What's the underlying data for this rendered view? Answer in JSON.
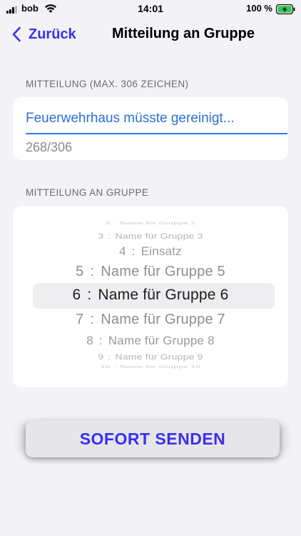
{
  "status_bar": {
    "carrier": "bob",
    "time": "14:01",
    "battery": "100 %"
  },
  "nav": {
    "back_label": "Zurück",
    "title": "Mitteilung an Gruppe"
  },
  "message_section": {
    "label": "MITTEILUNG (MAX. 306 ZEICHEN)",
    "value": "Feuerwehrhaus müsste gereinigt...",
    "counter": "268/306"
  },
  "group_section": {
    "label": "MITTEILUNG AN GRUPPE",
    "selected_index": 4,
    "options": [
      {
        "num": "2",
        "sep": ":",
        "name": "Name für Gruppe 2"
      },
      {
        "num": "3",
        "sep": ":",
        "name": "Name für Gruppe 3"
      },
      {
        "num": "4",
        "sep": ":",
        "name": "Einsatz"
      },
      {
        "num": "5",
        "sep": ":",
        "name": "Name für Gruppe 5"
      },
      {
        "num": "6",
        "sep": ":",
        "name": "Name für Gruppe 6"
      },
      {
        "num": "7",
        "sep": ":",
        "name": "Name für Gruppe 7"
      },
      {
        "num": "8",
        "sep": ":",
        "name": "Name für Gruppe 8"
      },
      {
        "num": "9",
        "sep": ":",
        "name": "Name für Gruppe 9"
      },
      {
        "num": "10",
        "sep": ":",
        "name": "Name für Gruppe 10"
      }
    ]
  },
  "send_button": {
    "label": "SOFORT SENDEN"
  },
  "colors": {
    "accent": "#3a2ff0",
    "field_text": "#2b6fd6",
    "background": "#f2f2f7"
  }
}
